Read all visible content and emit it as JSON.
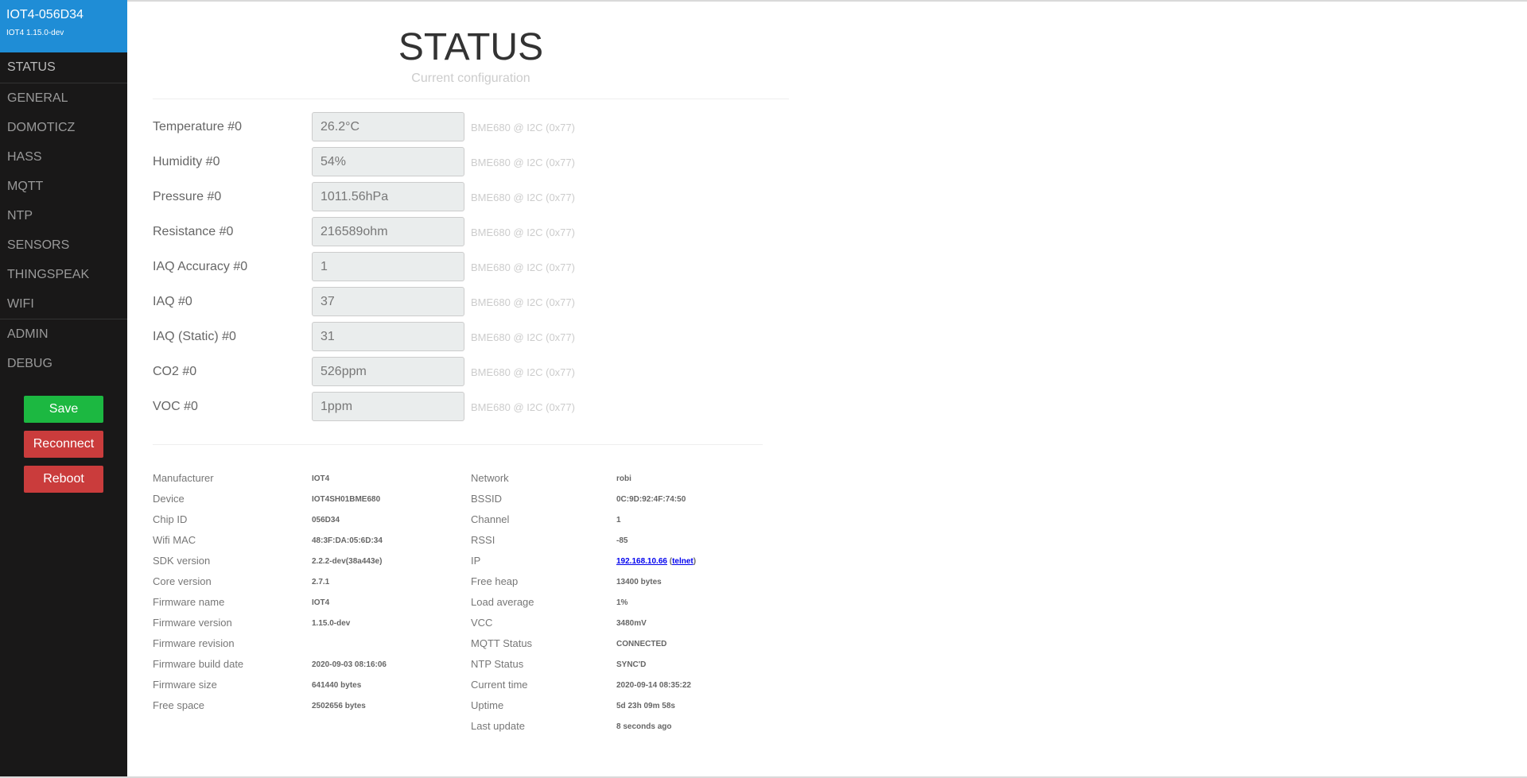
{
  "brand": {
    "title": "IOT4-056D34",
    "version": "IOT4 1.15.0-dev"
  },
  "menu": {
    "status": "STATUS",
    "general": "GENERAL",
    "domoticz": "DOMOTICZ",
    "hass": "HASS",
    "mqtt": "MQTT",
    "ntp": "NTP",
    "sensors": "SENSORS",
    "thingspeak": "THINGSPEAK",
    "wifi": "WIFI",
    "admin": "ADMIN",
    "debug": "DEBUG"
  },
  "buttons": {
    "save": "Save",
    "reconnect": "Reconnect",
    "reboot": "Reboot"
  },
  "colors": {
    "brand": "#1f8dd6",
    "sidebar": "#191818",
    "save": "#1cb841",
    "danger": "#ca3c3c"
  },
  "header": {
    "title": "STATUS",
    "subtitle": "Current configuration"
  },
  "sensors": [
    {
      "label": "Temperature #0",
      "value": "26.2°C",
      "note": "BME680 @ I2C (0x77)"
    },
    {
      "label": "Humidity #0",
      "value": "54%",
      "note": "BME680 @ I2C (0x77)"
    },
    {
      "label": "Pressure #0",
      "value": "1011.56hPa",
      "note": "BME680 @ I2C (0x77)"
    },
    {
      "label": "Resistance #0",
      "value": "216589ohm",
      "note": "BME680 @ I2C (0x77)"
    },
    {
      "label": "IAQ Accuracy #0",
      "value": "1",
      "note": "BME680 @ I2C (0x77)"
    },
    {
      "label": "IAQ #0",
      "value": "37",
      "note": "BME680 @ I2C (0x77)"
    },
    {
      "label": "IAQ (Static) #0",
      "value": "31",
      "note": "BME680 @ I2C (0x77)"
    },
    {
      "label": "CO2 #0",
      "value": "526ppm",
      "note": "BME680 @ I2C (0x77)"
    },
    {
      "label": "VOC #0",
      "value": "1ppm",
      "note": "BME680 @ I2C (0x77)"
    }
  ],
  "info_left": [
    {
      "label": "Manufacturer",
      "value": "IOT4"
    },
    {
      "label": "Device",
      "value": "IOT4SH01BME680"
    },
    {
      "label": "Chip ID",
      "value": "056D34"
    },
    {
      "label": "Wifi MAC",
      "value": "48:3F:DA:05:6D:34"
    },
    {
      "label": "SDK version",
      "value": "2.2.2-dev(38a443e)"
    },
    {
      "label": "Core version",
      "value": "2.7.1"
    },
    {
      "label": "Firmware name",
      "value": "IOT4"
    },
    {
      "label": "Firmware version",
      "value": "1.15.0-dev"
    },
    {
      "label": "Firmware revision",
      "value": ""
    },
    {
      "label": "Firmware build date",
      "value": "2020-09-03 08:16:06"
    },
    {
      "label": "Firmware size",
      "value": "641440 bytes"
    },
    {
      "label": "Free space",
      "value": "2502656 bytes"
    }
  ],
  "info_right": {
    "network": {
      "label": "Network",
      "value": "robi"
    },
    "bssid": {
      "label": "BSSID",
      "value": "0C:9D:92:4F:74:50"
    },
    "channel": {
      "label": "Channel",
      "value": "1"
    },
    "rssi": {
      "label": "RSSI",
      "value": "-85"
    },
    "ip": {
      "label": "IP",
      "value": "192.168.10.66",
      "open_paren": "(",
      "telnet": "telnet",
      "close_paren": ")"
    },
    "free_heap": {
      "label": "Free heap",
      "value": "13400 bytes"
    },
    "load_average": {
      "label": "Load average",
      "value": "1%"
    },
    "vcc": {
      "label": "VCC",
      "value": "3480mV"
    },
    "mqtt_status": {
      "label": "MQTT Status",
      "value": "CONNECTED"
    },
    "ntp_status": {
      "label": "NTP Status",
      "value": "SYNC'D"
    },
    "current_time": {
      "label": "Current time",
      "value": "2020-09-14 08:35:22"
    },
    "uptime": {
      "label": "Uptime",
      "value": "5d 23h 09m 58s"
    },
    "last_update": {
      "label": "Last update",
      "value": "8 seconds ago"
    }
  }
}
